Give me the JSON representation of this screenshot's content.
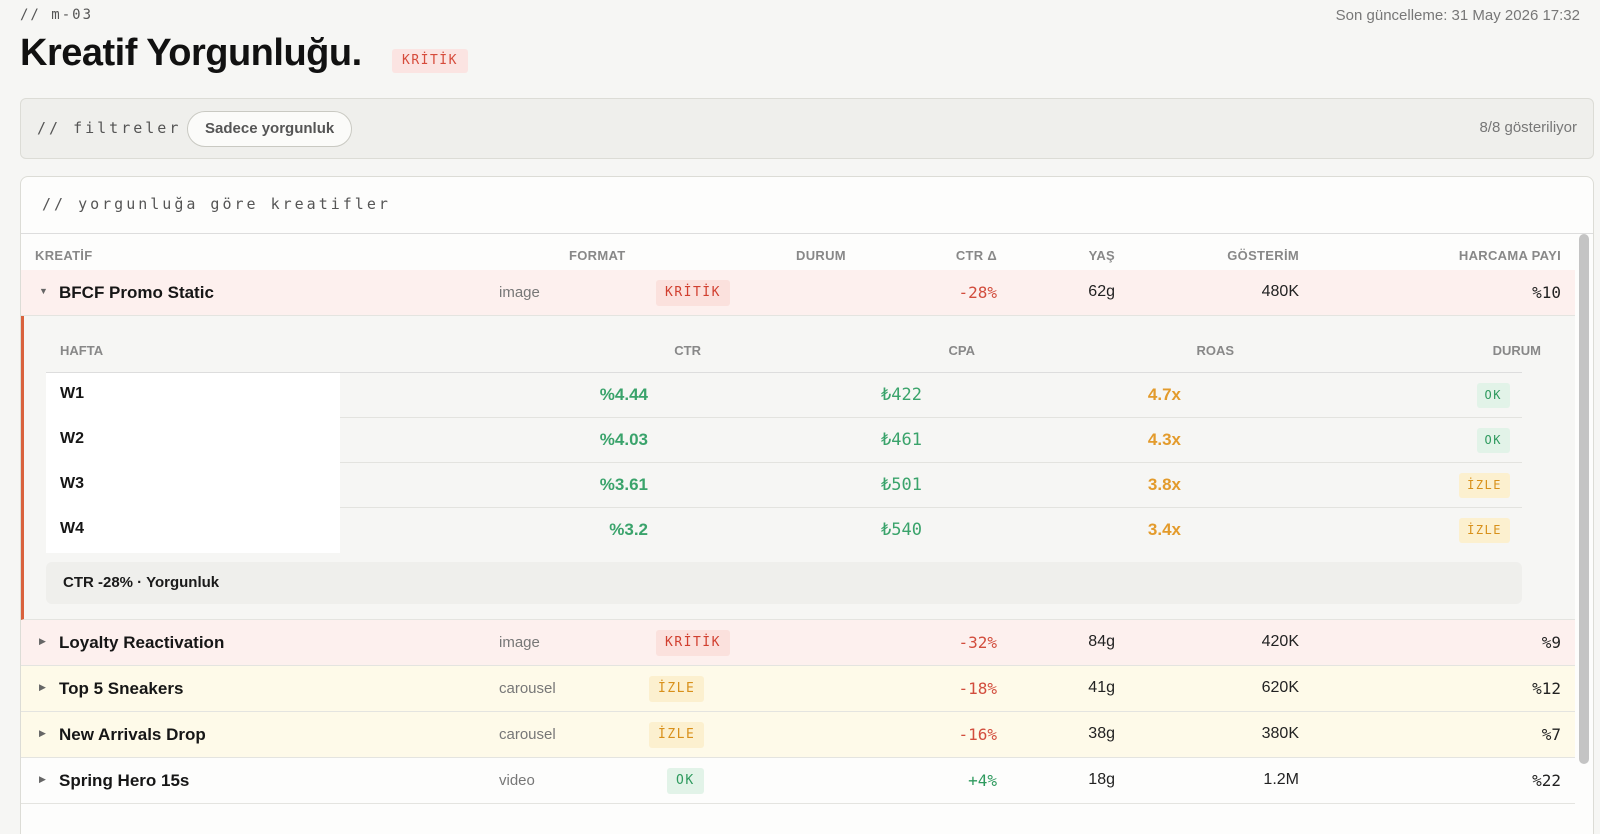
{
  "header": {
    "eyebrow": "// m-03",
    "title": "Kreatif Yorgunluğu.",
    "title_badge": "KRİTİK",
    "updated": "Son güncelleme: 31 May 2026 17:32"
  },
  "filters": {
    "label": "// filtreler",
    "chip": "Sadece yorgunluk",
    "count": "8/8 gösteriliyor"
  },
  "card": {
    "title": "// yorgunluğa göre kreatifler",
    "columns": [
      "KREATİF",
      "FORMAT",
      "DURUM",
      "CTR Δ",
      "YAŞ",
      "GÖSTERİM",
      "HARCAMA PAYI"
    ]
  },
  "rows": [
    {
      "name": "BFCF Promo Static",
      "format": "image",
      "status": "KRİTİK",
      "ctr": "-28%",
      "age": "62g",
      "impressions": "480K",
      "share": "%10",
      "expanded": true
    },
    {
      "name": "Loyalty Reactivation",
      "format": "image",
      "status": "KRİTİK",
      "ctr": "-32%",
      "age": "84g",
      "impressions": "420K",
      "share": "%9"
    },
    {
      "name": "Top 5 Sneakers",
      "format": "carousel",
      "status": "İZLE",
      "ctr": "-18%",
      "age": "41g",
      "impressions": "620K",
      "share": "%12"
    },
    {
      "name": "New Arrivals Drop",
      "format": "carousel",
      "status": "İZLE",
      "ctr": "-16%",
      "age": "38g",
      "impressions": "380K",
      "share": "%7"
    },
    {
      "name": "Spring Hero 15s",
      "format": "video",
      "status": "OK",
      "ctr": "+4%",
      "age": "18g",
      "impressions": "1.2M",
      "share": "%22"
    }
  ],
  "detail": {
    "columns": [
      "HAFTA",
      "CTR",
      "CPA",
      "ROAS",
      "DURUM"
    ],
    "weeks": [
      {
        "week": "W1",
        "ctr": "%4.44",
        "cpa": "₺422",
        "roas": "4.7x",
        "status": "OK"
      },
      {
        "week": "W2",
        "ctr": "%4.03",
        "cpa": "₺461",
        "roas": "4.3x",
        "status": "OK"
      },
      {
        "week": "W3",
        "ctr": "%3.61",
        "cpa": "₺501",
        "roas": "3.8x",
        "status": "İZLE"
      },
      {
        "week": "W4",
        "ctr": "%3.2",
        "cpa": "₺540",
        "roas": "3.4x",
        "status": "İZLE"
      }
    ],
    "note": "CTR -28% · Yorgunluk"
  },
  "colors": {
    "critical": "#d13f2f",
    "watch": "#d8901a",
    "ok": "#2e9a5e",
    "accent_border": "#d9623d"
  }
}
